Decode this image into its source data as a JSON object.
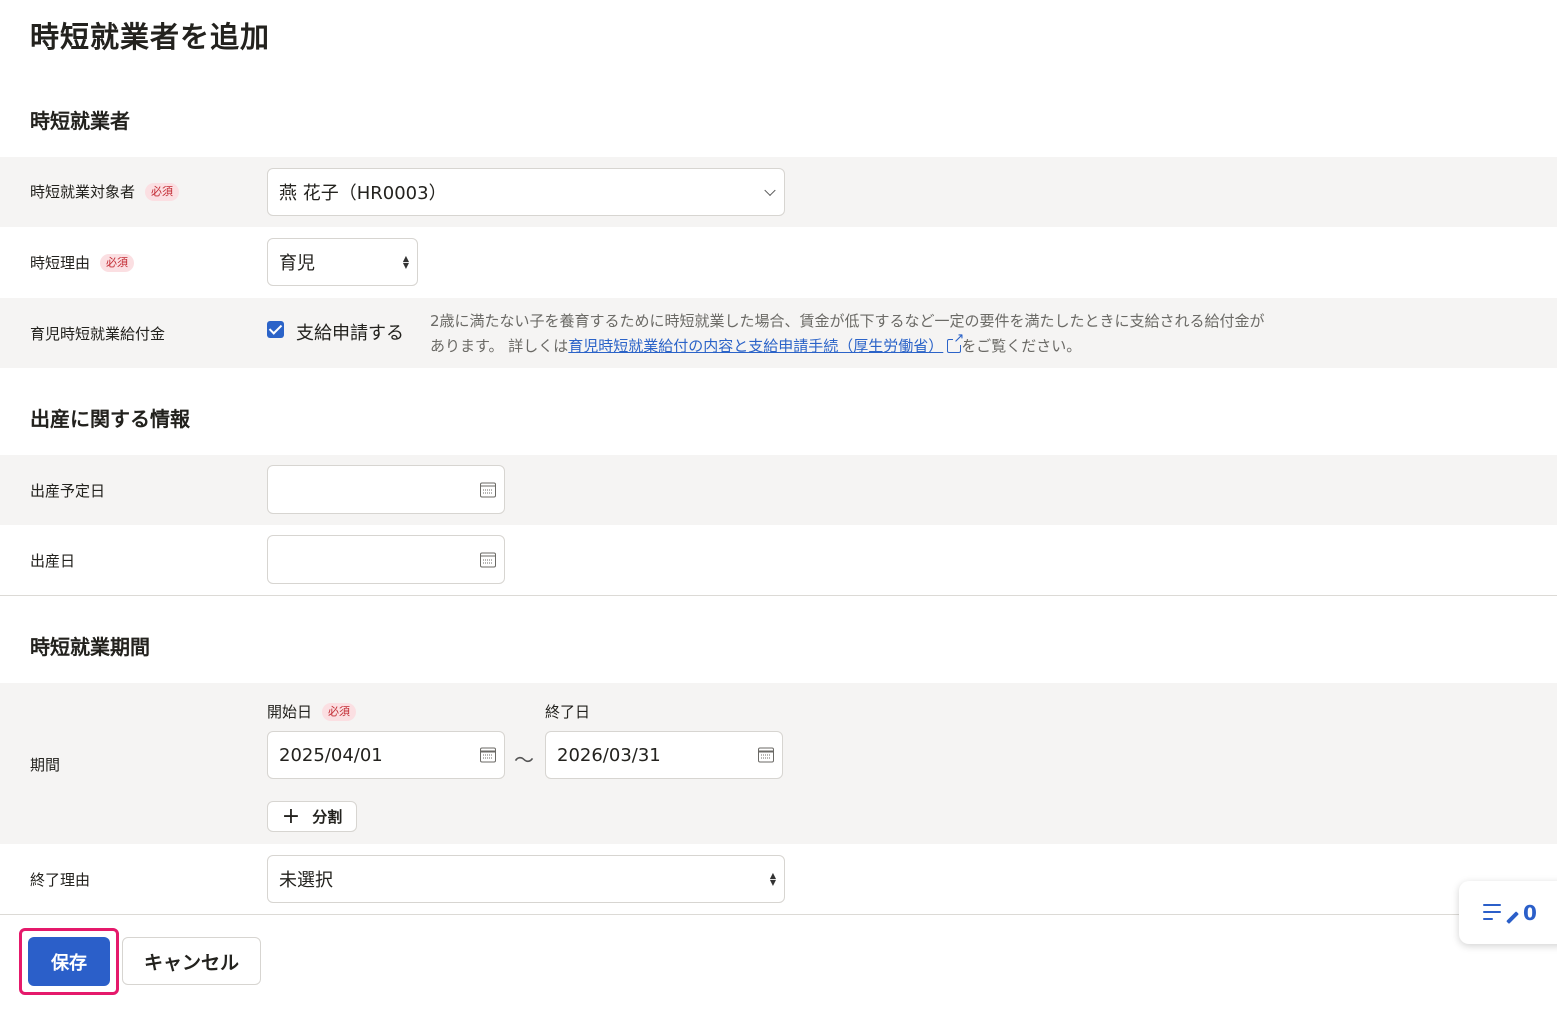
{
  "page": {
    "title": "時短就業者を追加"
  },
  "sections": {
    "employee": "時短就業者",
    "birth": "出産に関する情報",
    "period": "時短就業期間"
  },
  "required_badge": "必須",
  "fields": {
    "target": {
      "label": "時短就業対象者",
      "value": "燕 花子（HR0003）"
    },
    "reason": {
      "label": "時短理由",
      "value": "育児"
    },
    "benefit": {
      "label": "育児時短就業給付金",
      "checkbox_label": "支給申請する",
      "checked": true,
      "help_line1": "2歳に満たない子を養育するために時短就業した場合、賃金が低下するなど一定の要件を満たしたときに支給される給付金が",
      "help_line2_prefix": "あります。 詳しくは",
      "help_link": "育児時短就業給付の内容と支給申請手続（厚生労働省）",
      "help_suffix": "をご覧ください。"
    },
    "due_date": {
      "label": "出産予定日",
      "value": ""
    },
    "birth_date": {
      "label": "出産日",
      "value": ""
    },
    "period": {
      "label": "期間",
      "start_label": "開始日",
      "start_value": "2025/04/01",
      "separator": "～",
      "end_label": "終了日",
      "end_value": "2026/03/31",
      "split_button": "分割"
    },
    "end_reason": {
      "label": "終了理由",
      "value": "未選択"
    }
  },
  "actions": {
    "save": "保存",
    "cancel": "キャンセル"
  },
  "floating": {
    "count": "0",
    "icon": "notes-edit-icon"
  },
  "colors": {
    "primary": "#2b5fc9",
    "highlight": "#e5196b",
    "badge_bg": "#fbdfe2",
    "badge_text": "#c22b33"
  }
}
